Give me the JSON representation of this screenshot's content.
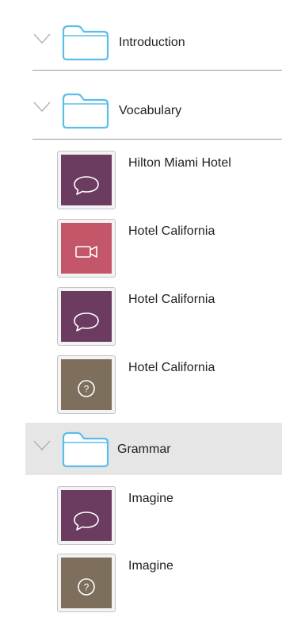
{
  "colors": {
    "folder_outline": "#5bbde9",
    "chevron": "#a9a9a9",
    "chat_tile": "#6b3c5f",
    "video_tile": "#c4566a",
    "quiz_tile": "#7d6f5c",
    "selected_row": "#e6e6e6",
    "divider": "#9a9a9a"
  },
  "tree": {
    "folders": [
      {
        "label": "Introduction",
        "icon": "folder-icon",
        "expand_icon": "chevron-down-icon",
        "selected": false,
        "items": []
      },
      {
        "label": "Vocabulary",
        "icon": "folder-icon",
        "expand_icon": "chevron-down-icon",
        "selected": false,
        "items": [
          {
            "label": "Hilton Miami Hotel",
            "type": "conversation",
            "icon": "speech-bubble-icon"
          },
          {
            "label": "Hotel California",
            "type": "video",
            "icon": "video-camera-icon"
          },
          {
            "label": "Hotel California",
            "type": "conversation",
            "icon": "speech-bubble-icon"
          },
          {
            "label": "Hotel California",
            "type": "quiz",
            "icon": "question-mark-icon"
          }
        ]
      },
      {
        "label": "Grammar",
        "icon": "folder-icon",
        "expand_icon": "chevron-down-icon",
        "selected": true,
        "items": [
          {
            "label": "Imagine",
            "type": "conversation",
            "icon": "speech-bubble-icon"
          },
          {
            "label": "Imagine",
            "type": "quiz",
            "icon": "question-mark-icon"
          }
        ]
      }
    ]
  }
}
